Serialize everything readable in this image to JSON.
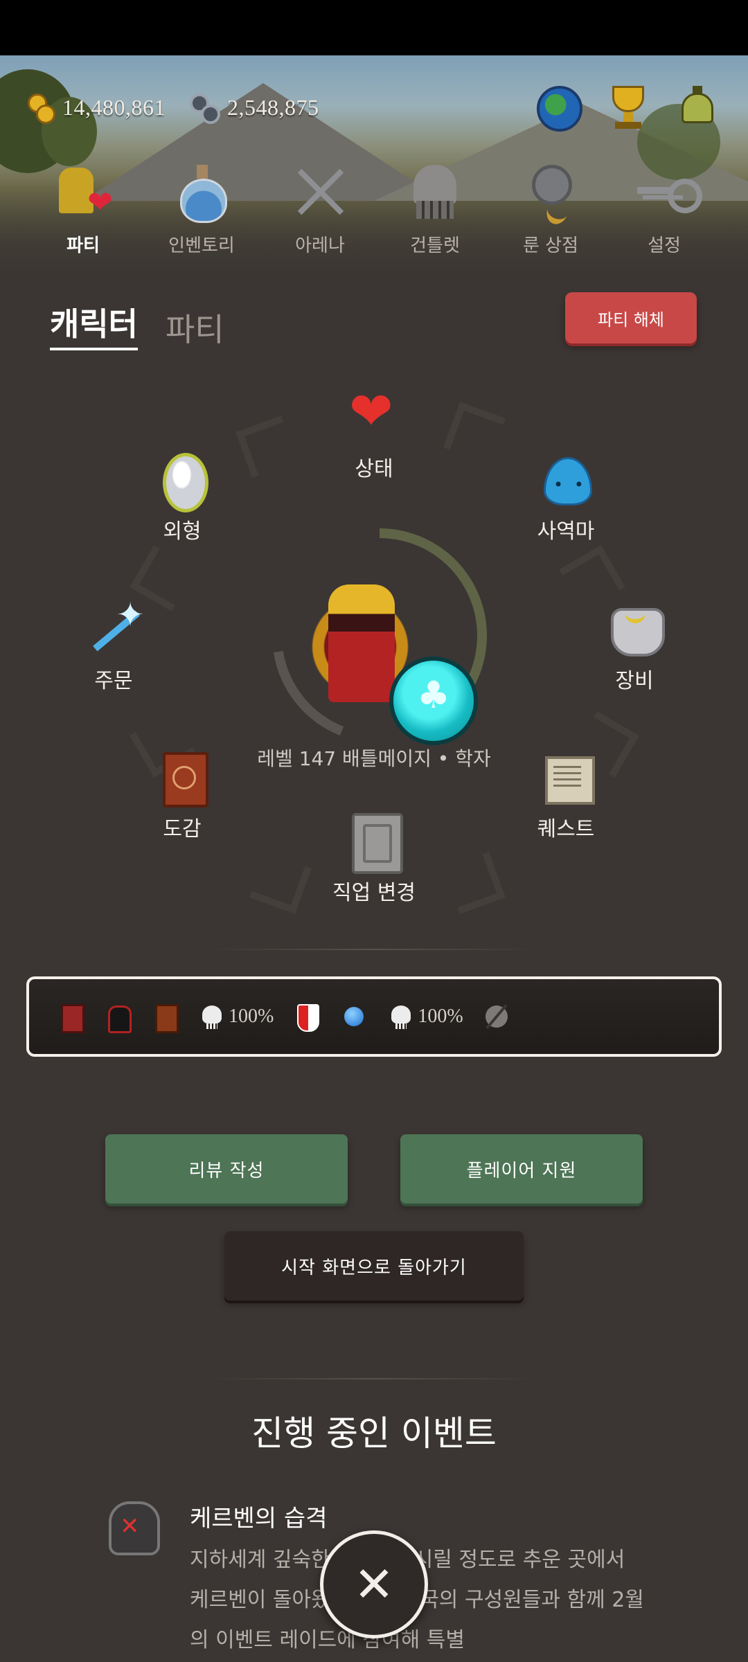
{
  "header": {
    "gold": "14,480,861",
    "gems": "2,548,875",
    "icons": [
      "coin-icon",
      "gem-icon",
      "globe-icon",
      "trophy-icon",
      "bell-icon"
    ]
  },
  "nav": {
    "items": [
      {
        "label": "파티",
        "icon": "party-icon",
        "active": true
      },
      {
        "label": "인벤토리",
        "icon": "potion-icon",
        "active": false
      },
      {
        "label": "아레나",
        "icon": "swords-icon",
        "active": false
      },
      {
        "label": "건틀렛",
        "icon": "gauntlet-icon",
        "active": false
      },
      {
        "label": "룬 상점",
        "icon": "rune-icon",
        "active": false
      },
      {
        "label": "설정",
        "icon": "key-icon",
        "active": false
      }
    ]
  },
  "subtabs": {
    "character": "캐릭터",
    "party": "파티",
    "active": "character"
  },
  "disband_button": "파티 해체",
  "menu": {
    "status": "상태",
    "appearance": "외형",
    "familiar": "사역마",
    "spells": "주문",
    "equipment": "장비",
    "codex": "도감",
    "quests": "퀘스트",
    "job_change": "직업 변경"
  },
  "character": {
    "level_line": "레벨 147 배틀메이지 • 학자",
    "progress": 0.42
  },
  "status_effects": [
    {
      "icon": "red-book-icon"
    },
    {
      "icon": "cloak-icon"
    },
    {
      "icon": "brown-book-icon"
    },
    {
      "icon": "skull-icon",
      "value": "100%"
    },
    {
      "icon": "shield-icon"
    },
    {
      "icon": "blue-orb-icon"
    },
    {
      "icon": "skull-icon",
      "value": "100%"
    },
    {
      "icon": "no-slash-icon"
    }
  ],
  "buttons": {
    "review": "리뷰 작성",
    "support": "플레이어 지원",
    "home": "시작 화면으로 돌아가기"
  },
  "events": {
    "title": "진행 중인 이벤트",
    "items": [
      {
        "name": "케르벤의 습격",
        "description": "지하세계 깊숙한 곳, 뼈가 시릴 정도로 추운 곳에서 케르벤이 돌아왔습니다. 왕국의 구성원들과 함께 2월의 이벤트 레이드에 참여해 특별"
      }
    ]
  },
  "colors": {
    "background": "#3b3633",
    "accent_red": "#c84848",
    "button_green": "#4e7556",
    "progress_ring": "#5f6447"
  }
}
